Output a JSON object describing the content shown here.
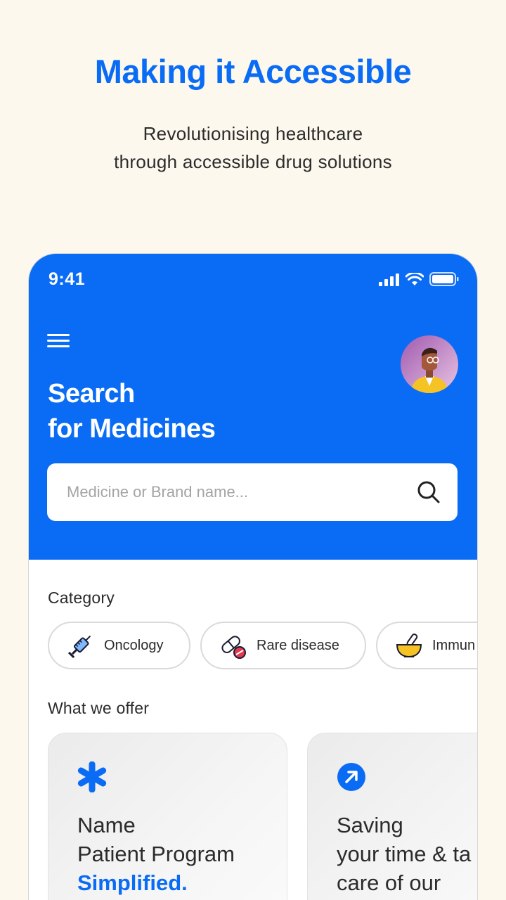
{
  "headline": "Making it Accessible",
  "subline": [
    "Revolutionising healthcare",
    "through accessible drug solutions"
  ],
  "status_bar": {
    "time": "9:41"
  },
  "hero": {
    "title_lines": [
      "Search",
      "for Medicines"
    ],
    "search_placeholder": "Medicine or Brand name..."
  },
  "category": {
    "label": "Category",
    "chips": [
      {
        "label": "Oncology",
        "icon": "syringe-icon"
      },
      {
        "label": "Rare disease",
        "icon": "pills-icon"
      },
      {
        "label": "Immun",
        "icon": "mortar-pestle-icon"
      }
    ]
  },
  "offer": {
    "label": "What we offer",
    "cards": [
      {
        "icon": "asterisk-icon",
        "lines": [
          "Name",
          "Patient Program"
        ],
        "accent": "Simplified."
      },
      {
        "icon": "arrow-up-right-icon",
        "lines": [
          "Saving",
          "your time & ta",
          "care of our"
        ],
        "accent": ""
      }
    ]
  },
  "colors": {
    "brand": "#0A6CF5",
    "background": "#FCF8EE"
  }
}
